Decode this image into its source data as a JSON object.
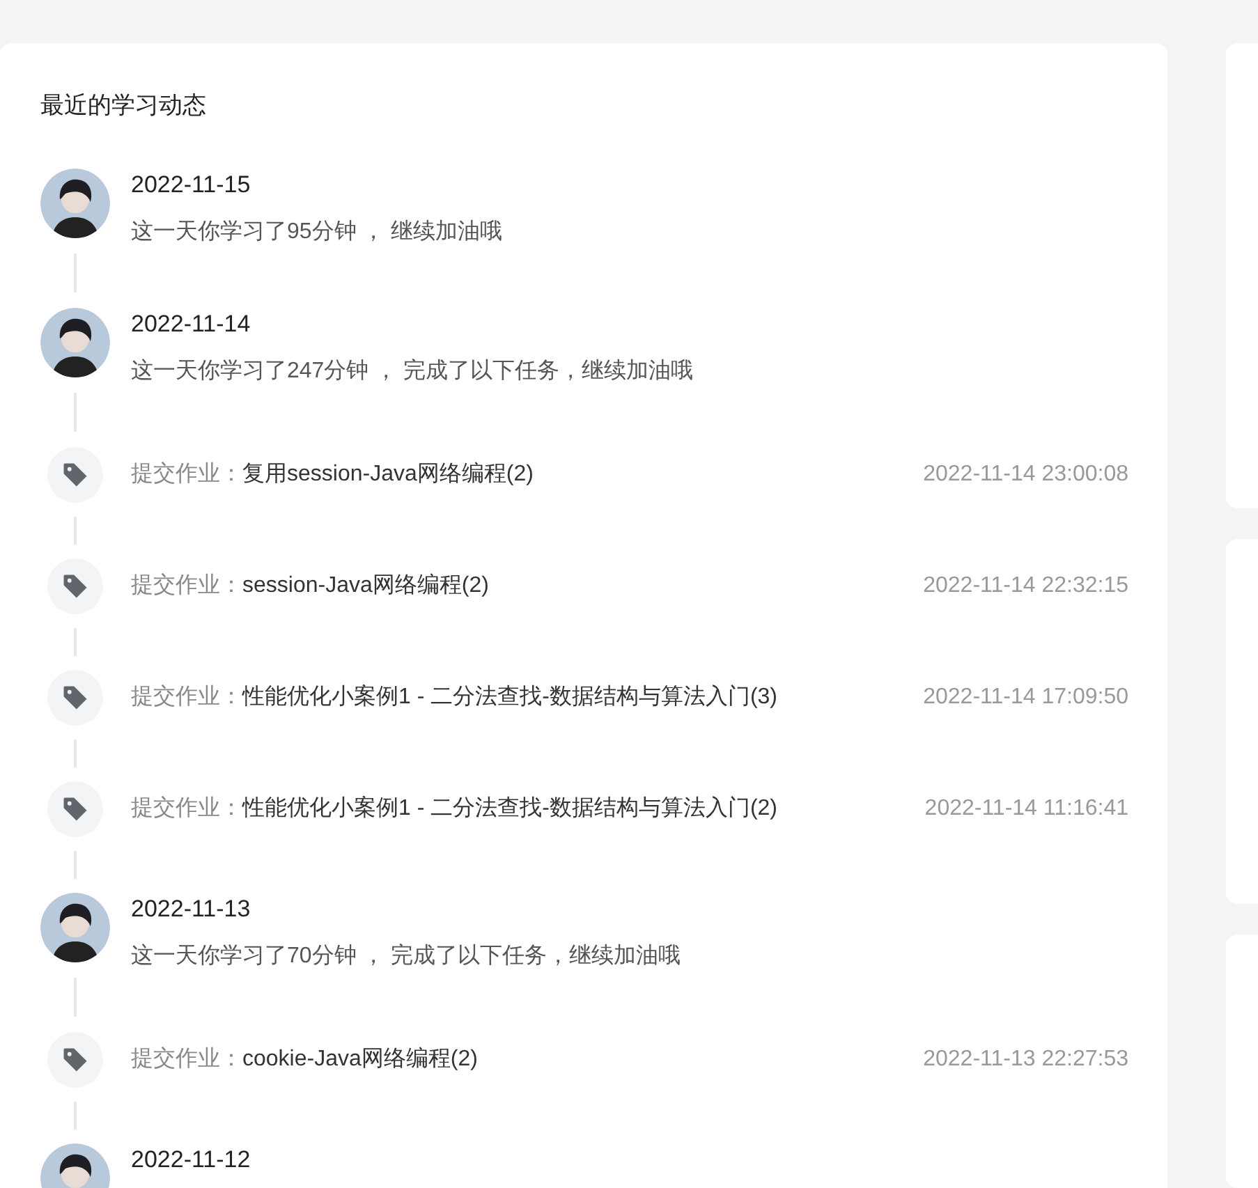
{
  "feed": {
    "title": "最近的学习动态",
    "entries": [
      {
        "kind": "day",
        "date": "2022-11-15",
        "summary": "这一天你学习了95分钟 ， 继续加油哦"
      },
      {
        "kind": "day",
        "date": "2022-11-14",
        "summary": "这一天你学习了247分钟 ， 完成了以下任务，继续加油哦"
      },
      {
        "kind": "task",
        "label": "提交作业：",
        "name": "复用session-Java网络编程(2)",
        "time": "2022-11-14 23:00:08"
      },
      {
        "kind": "task",
        "label": "提交作业：",
        "name": "session-Java网络编程(2)",
        "time": "2022-11-14 22:32:15"
      },
      {
        "kind": "task",
        "label": "提交作业：",
        "name": "性能优化小案例1 - 二分法查找-数据结构与算法入门(3)",
        "time": "2022-11-14 17:09:50"
      },
      {
        "kind": "task",
        "label": "提交作业：",
        "name": "性能优化小案例1 - 二分法查找-数据结构与算法入门(2)",
        "time": "2022-11-14 11:16:41"
      },
      {
        "kind": "day",
        "date": "2022-11-13",
        "summary": "这一天你学习了70分钟 ， 完成了以下任务，继续加油哦"
      },
      {
        "kind": "task",
        "label": "提交作业：",
        "name": "cookie-Java网络编程(2)",
        "time": "2022-11-13 22:27:53"
      },
      {
        "kind": "day",
        "date": "2022-11-12"
      }
    ]
  }
}
